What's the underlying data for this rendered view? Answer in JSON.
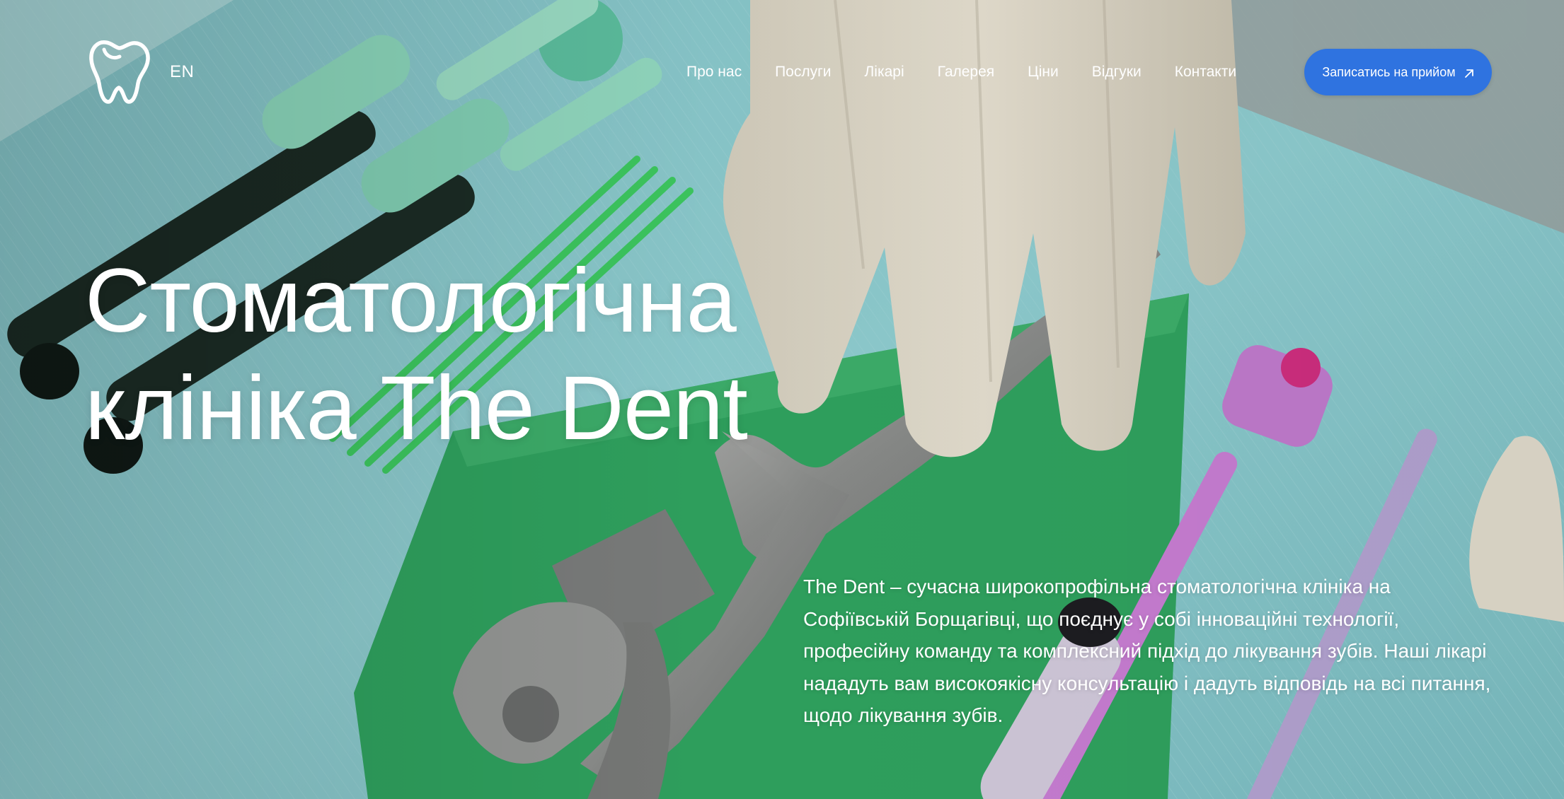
{
  "header": {
    "logo_icon": "tooth-logo-icon",
    "language": "EN",
    "nav": [
      {
        "label": "Про нас"
      },
      {
        "label": "Послуги"
      },
      {
        "label": "Лікарі"
      },
      {
        "label": "Галерея"
      },
      {
        "label": "Ціни"
      },
      {
        "label": "Відгуки"
      },
      {
        "label": "Контакти"
      }
    ],
    "cta": {
      "label": "Записатись на прийом",
      "icon": "arrow-up-right-icon",
      "color": "#2f73e0"
    }
  },
  "hero": {
    "title_line1": "Стоматологічна",
    "title_line2": "клініка The Dent",
    "description": "The Dent – сучасна широкопрофільна стоматологічна клініка на Софіївській Борщагівці, що поєднує у собі інноваційні технології, професійну команду та комплексний підхід до лікування зубів. Наші лікарі нададуть вам високоякісну консультацію і дадуть відповідь на всі питання, щодо лікування зубів."
  }
}
